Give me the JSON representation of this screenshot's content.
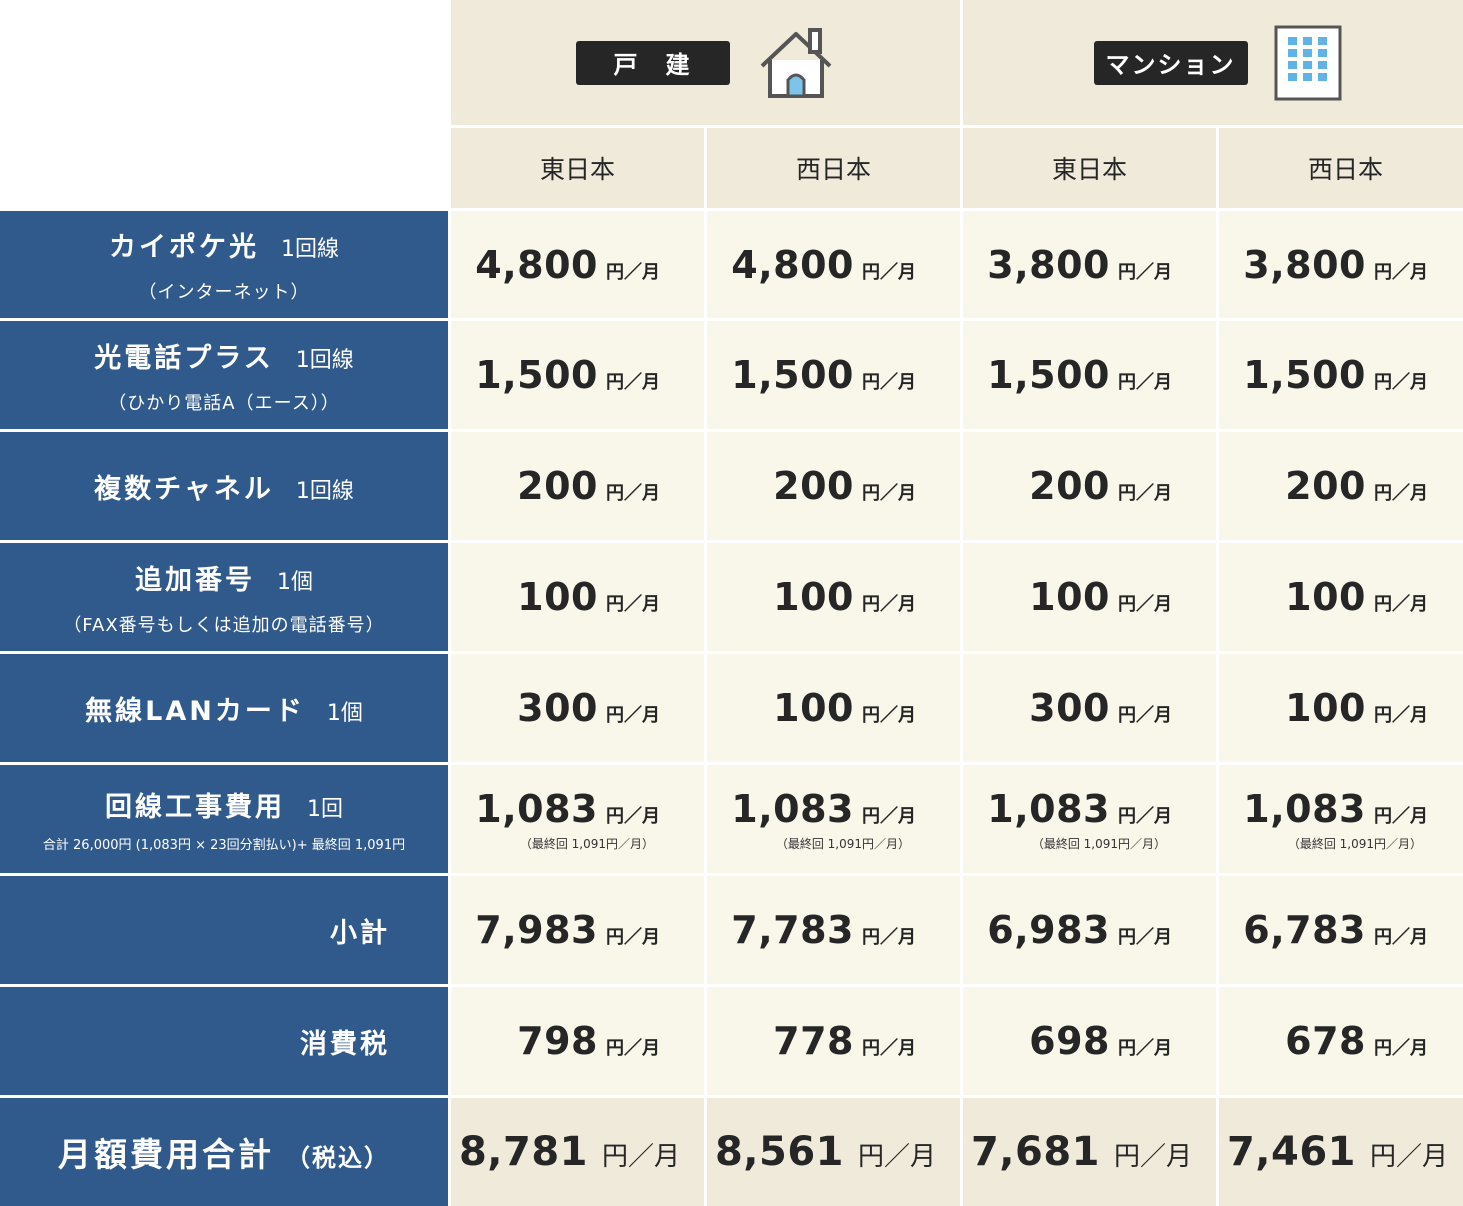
{
  "header": {
    "house": {
      "label": "戸　建",
      "icon": "house-icon"
    },
    "mansion": {
      "label": "マンション",
      "icon": "building-icon"
    }
  },
  "regions": [
    "東日本",
    "西日本",
    "東日本",
    "西日本"
  ],
  "price_unit": "円／月",
  "rows": [
    {
      "label": "カイポケ光",
      "unit": "1回線",
      "sub": "（インターネット）",
      "values": [
        "4,800",
        "4,800",
        "3,800",
        "3,800"
      ]
    },
    {
      "label": "光電話プラス",
      "unit": "1回線",
      "sub": "（ひかり電話A（エース））",
      "values": [
        "1,500",
        "1,500",
        "1,500",
        "1,500"
      ]
    },
    {
      "label": "複数チャネル",
      "unit": "1回線",
      "values": [
        "200",
        "200",
        "200",
        "200"
      ]
    },
    {
      "label": "追加番号",
      "unit": "1個",
      "sub": "（FAX番号もしくは追加の電話番号）",
      "values": [
        "100",
        "100",
        "100",
        "100"
      ]
    },
    {
      "label": "無線LANカード",
      "unit": "1個",
      "values": [
        "300",
        "100",
        "300",
        "100"
      ]
    },
    {
      "label": "回線工事費用",
      "unit": "1回",
      "sub": "合計 26,000円 (1,083円 × 23回分割払い)+ 最終回 1,091円",
      "values": [
        "1,083",
        "1,083",
        "1,083",
        "1,083"
      ],
      "note": "（最終回 1,091円／月）"
    },
    {
      "label": "小計",
      "values": [
        "7,983",
        "7,783",
        "6,983",
        "6,783"
      ]
    },
    {
      "label": "消費税",
      "values": [
        "798",
        "778",
        "698",
        "678"
      ]
    }
  ],
  "total": {
    "label": "月額費用合計",
    "tax_label": "（税込）",
    "values": [
      "8,781",
      "8,561",
      "7,681",
      "7,461"
    ]
  }
}
